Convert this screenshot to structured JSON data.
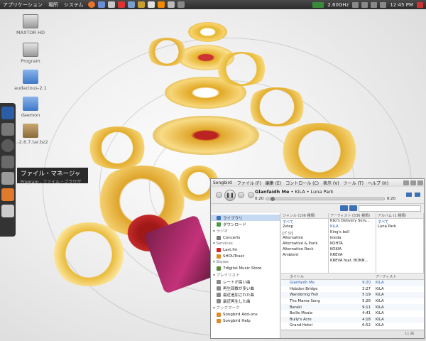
{
  "top_panel": {
    "menus": [
      "アプリケーション",
      "場所",
      "システム"
    ],
    "cpu_freq": "2.60GHz",
    "clock": "12:45 PM"
  },
  "desktop_icons": [
    {
      "label": "MAXTOR HD",
      "icon": "hard-drive-icon"
    },
    {
      "label": "Program",
      "icon": "hard-drive-icon"
    },
    {
      "label": "audacious-2.1",
      "icon": "folder-icon"
    },
    {
      "label": "daemon",
      "icon": "folder-icon"
    },
    {
      "label": "...-2.6.7.tar.bz2",
      "icon": "archive-icon"
    }
  ],
  "dock_tooltip": {
    "title": "ファイル・マネージャ",
    "subtitle": "Program - ファイル・ブラウザ"
  },
  "songbird": {
    "app_title": "Songbird",
    "menus": [
      "ファイル (F)",
      "編集 (E)",
      "コントロール (C)",
      "表示 (V)",
      "ツール (T)",
      "ヘルプ (H)"
    ],
    "now_playing": {
      "song": "Glanfaidh Me",
      "separator": " • ",
      "artist_album": "KiLA • Luna Park",
      "elapsed": "0:20",
      "duration": "9:20",
      "progress": 0.036
    },
    "sidebar": {
      "sections": [
        {
          "heading": "",
          "items": [
            {
              "label": "ライブラリ",
              "selected": true
            },
            {
              "label": "ダウンロード"
            }
          ]
        },
        {
          "heading": "ラジオ",
          "items": [
            {
              "label": "Concerts"
            }
          ]
        },
        {
          "heading": "Services",
          "items": [
            {
              "label": "Last.fm"
            },
            {
              "label": "SHOUTcast"
            }
          ]
        },
        {
          "heading": "Stores",
          "items": [
            {
              "label": "7digital Music Store"
            }
          ]
        },
        {
          "heading": "プレイリスト",
          "items": [
            {
              "label": "レートが高い曲"
            },
            {
              "label": "再生回数が多い曲"
            },
            {
              "label": "最近追加された曲"
            },
            {
              "label": "最近再生した曲"
            }
          ]
        },
        {
          "heading": "ブックマーク",
          "items": [
            {
              "label": "Songbird Add-ons"
            },
            {
              "label": "Songbird Help"
            }
          ]
        }
      ]
    },
    "filters": [
      {
        "header": "ジャンル (106 種類)",
        "items": [
          "すべて",
          "2step",
          "[ｸﾞﾗﾌ]",
          "Alternative",
          "Alternative & Punk",
          "Alternative Rock",
          "Ambient"
        ],
        "selected": 0
      },
      {
        "header": "アーティスト (536 種類)",
        "items": [
          "Kiki's Delivery Serv...",
          "KiLA",
          "King's bell",
          "kisida",
          "KOHTA",
          "KOKIA",
          "KREVA",
          "KREVA feat. BONN..."
        ],
        "selected": 1
      },
      {
        "header": "アルバム (1 種類)",
        "items": [
          "すべて",
          "Luna Park"
        ],
        "selected": 0
      }
    ],
    "track_columns": [
      "タイトル",
      "",
      "アーティスト"
    ],
    "tracks": [
      {
        "title": "Glanfaidh Me",
        "time": "9:20",
        "artist": "KiLA",
        "playing": true
      },
      {
        "title": "Hebden Bridge",
        "time": "3:27",
        "artist": "KiLA"
      },
      {
        "title": "Wandering Fish",
        "time": "5:19",
        "artist": "KiLA"
      },
      {
        "title": "The Mama Song",
        "time": "5:26",
        "artist": "KiLA"
      },
      {
        "title": "Baraki",
        "time": "9:11",
        "artist": "KiLA"
      },
      {
        "title": "Beille Meala",
        "time": "4:41",
        "artist": "KiLA"
      },
      {
        "title": "Bully's Acre",
        "time": "4:18",
        "artist": "KiLA"
      },
      {
        "title": "Grand Hotel",
        "time": "6:52",
        "artist": "KiLA"
      }
    ],
    "status": "11 曲"
  }
}
